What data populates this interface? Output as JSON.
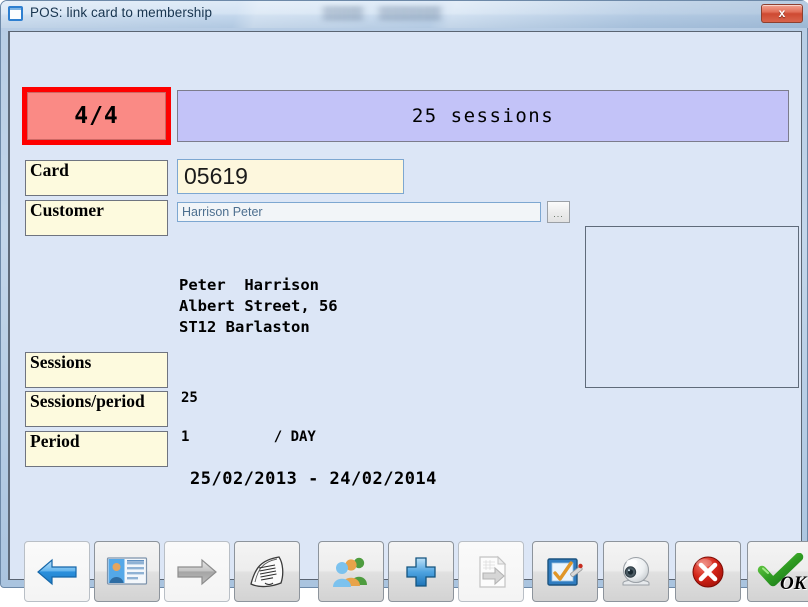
{
  "window": {
    "title": "POS: link card to membership",
    "icon": "window-icon",
    "close_label": "x",
    "accent_blue": "#7da7d1",
    "client_bg": "#dce6f6"
  },
  "counter": {
    "value": "4/4",
    "border_color": "#fe0000",
    "fill_color": "#fa8a85"
  },
  "banner": {
    "text": "25 sessions",
    "fill_color": "#c3c3f8"
  },
  "fields": {
    "card": {
      "label": "Card",
      "value": "05619",
      "placeholder": "",
      "bg_color": "#fdf7dd"
    },
    "customer": {
      "label": "Customer",
      "value": "Harrison Peter",
      "placeholder": "",
      "picker_label": "...",
      "text_color": "#4d6f8f"
    },
    "sessions": {
      "label": "Sessions",
      "value": "25"
    },
    "sessions_per_period": {
      "label": "Sessions/period",
      "value": "1          / DAY"
    },
    "period": {
      "label": "Period",
      "value": "25/02/2013 - 24/02/2014"
    }
  },
  "address": {
    "lines": "Peter  Harrison\nAlbert Street, 56\nST12 Barlaston"
  },
  "photo": {
    "caption": ""
  },
  "toolbar": {
    "buttons": [
      {
        "name": "previous-button",
        "icon": "arrow-left-blue-icon",
        "label": ""
      },
      {
        "name": "customer-card-button",
        "icon": "contact-card-icon",
        "label": ""
      },
      {
        "name": "next-button",
        "icon": "arrow-right-gray-icon",
        "label": ""
      },
      {
        "name": "print-button",
        "icon": "newspaper-icon",
        "label": ""
      },
      {
        "name": "members-button",
        "icon": "people-group-icon",
        "label": ""
      },
      {
        "name": "add-button",
        "icon": "plus-blue-icon",
        "label": ""
      },
      {
        "name": "export-button",
        "icon": "export-document-icon",
        "label": ""
      },
      {
        "name": "checklist-button",
        "icon": "clipboard-check-icon",
        "label": ""
      },
      {
        "name": "webcam-button",
        "icon": "webcam-icon",
        "label": ""
      },
      {
        "name": "cancel-button",
        "icon": "red-x-circle-icon",
        "label": ""
      },
      {
        "name": "ok-button",
        "icon": "green-check-icon",
        "label": "OK"
      }
    ]
  }
}
